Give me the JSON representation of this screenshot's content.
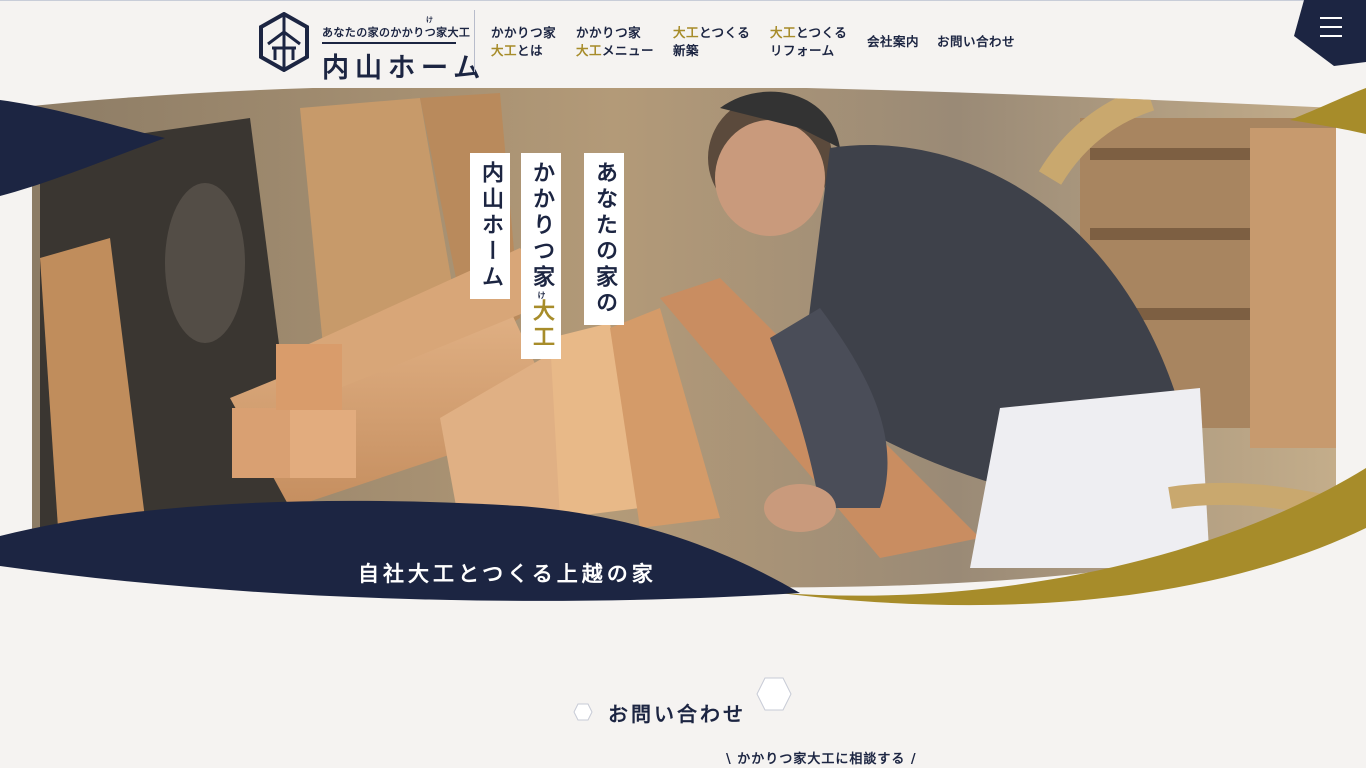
{
  "header": {
    "logo": {
      "tagline": "あなたの家のかかりつ家大工",
      "tagline_ruby": "け",
      "name": "内山ホーム"
    },
    "nav": [
      {
        "line1": "かかりつ家",
        "line2_gold": "大工",
        "line2": "とは"
      },
      {
        "line1": "かかりつ家",
        "line2_gold": "大工",
        "line2": "メニュー"
      },
      {
        "line1_gold": "大工",
        "line1": "とつくる",
        "line2": "新築"
      },
      {
        "line1_gold": "大工",
        "line1": "とつくる",
        "line2": "リフォーム"
      },
      {
        "label": "会社案内"
      },
      {
        "label": "お問い合わせ"
      }
    ],
    "menu_icon": "hamburger-icon"
  },
  "hero": {
    "vertical_titles": {
      "col1": "あなたの家の",
      "col2_plain": "かかりつ家",
      "col2_ruby": "け",
      "col2_gold": "大工",
      "col3": "内山ホーム"
    },
    "caption": "自社大工とつくる上越の家"
  },
  "contact": {
    "title": "お問い合わせ",
    "subtitle": "\\ かかりつ家大工に相談する /"
  },
  "colors": {
    "navy": "#1c2542",
    "gold": "#a78c2a",
    "background": "#f5f3f1"
  }
}
